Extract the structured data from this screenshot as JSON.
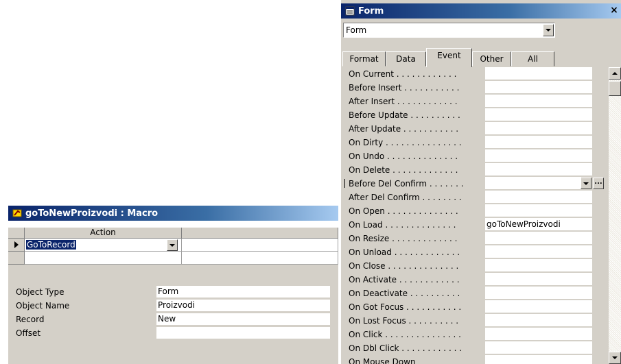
{
  "macro_window": {
    "title": "goToNewProizvodi : Macro",
    "column_header": "Action",
    "action_row": {
      "action": "GoToRecord"
    },
    "arguments": [
      {
        "label": "Object Type",
        "value": "Form"
      },
      {
        "label": "Object Name",
        "value": "Proizvodi"
      },
      {
        "label": "Record",
        "value": "New"
      },
      {
        "label": "Offset",
        "value": ""
      }
    ]
  },
  "property_sheet": {
    "title": "Form",
    "close_glyph": "×",
    "object_selector": "Form",
    "tabs": [
      {
        "label": "Format",
        "active": false
      },
      {
        "label": "Data",
        "active": false
      },
      {
        "label": "Event",
        "active": true
      },
      {
        "label": "Other",
        "active": false
      },
      {
        "label": "All",
        "active": false
      }
    ],
    "build_button": "...",
    "properties": [
      {
        "label": "On Current . . . . . . . . . . . .",
        "value": ""
      },
      {
        "label": "Before Insert . . . . . . . . . . .",
        "value": ""
      },
      {
        "label": "After Insert . . . . . . . . . . . .",
        "value": ""
      },
      {
        "label": "Before Update . . . . . . . . . .",
        "value": ""
      },
      {
        "label": "After Update . . . . . . . . . . .",
        "value": ""
      },
      {
        "label": "On Dirty . . . . . . . . . . . . . . .",
        "value": ""
      },
      {
        "label": "On Undo . . . . . . . . . . . . . .",
        "value": ""
      },
      {
        "label": "On Delete . . . . . . . . . . . . .",
        "value": ""
      },
      {
        "label": "Before Del Confirm . . . . . . .",
        "value": ""
      },
      {
        "label": "After Del Confirm . . . . . . . .",
        "value": ""
      },
      {
        "label": "On Open . . . . . . . . . . . . . .",
        "value": ""
      },
      {
        "label": "On Load . . . . . . . . . . . . . .",
        "value": "goToNewProizvodi"
      },
      {
        "label": "On Resize . . . . . . . . . . . . .",
        "value": ""
      },
      {
        "label": "On Unload . . . . . . . . . . . . .",
        "value": ""
      },
      {
        "label": "On Close . . . . . . . . . . . . . .",
        "value": ""
      },
      {
        "label": "On Activate . . . . . . . . . . . .",
        "value": ""
      },
      {
        "label": "On Deactivate . . . . . . . . . .",
        "value": ""
      },
      {
        "label": "On Got Focus . . . . . . . . . . .",
        "value": ""
      },
      {
        "label": "On Lost Focus . . . . . . . . . .",
        "value": ""
      },
      {
        "label": "On Click . . . . . . . . . . . . . . .",
        "value": ""
      },
      {
        "label": "On Dbl Click . . . . . . . . . . . .",
        "value": ""
      },
      {
        "label": "On Mouse Down",
        "value": ""
      }
    ]
  },
  "colors": {
    "title_active": "#0a246a",
    "title_fade": "#a6caf0",
    "face": "#d4d0c8"
  }
}
